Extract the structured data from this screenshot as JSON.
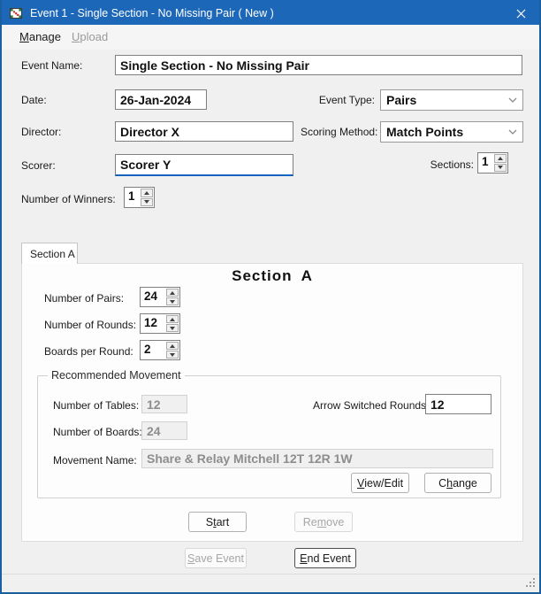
{
  "colors": {
    "titlebar": "#1c67b8",
    "window_border": "#1a5f9e",
    "focus_underline": "#1463bf",
    "disabled_text": "#8d8d8d"
  },
  "window": {
    "title": "Event 1 - Single Section - No Missing Pair ( New )"
  },
  "menu": {
    "items": [
      {
        "label": "Manage",
        "mnemonic": 0,
        "enabled": true
      },
      {
        "label": "Upload",
        "mnemonic": 0,
        "enabled": false
      }
    ]
  },
  "form": {
    "event_name": {
      "label": "Event Name:",
      "value": "Single Section - No Missing Pair"
    },
    "date": {
      "label": "Date:",
      "value": "26-Jan-2024"
    },
    "event_type": {
      "label": "Event Type:",
      "value": "Pairs"
    },
    "director": {
      "label": "Director:",
      "value": "Director X"
    },
    "scoring_method": {
      "label": "Scoring Method:",
      "value": "Match Points"
    },
    "scorer": {
      "label": "Scorer:",
      "value": "Scorer Y"
    },
    "sections": {
      "label": "Sections:",
      "value": "1"
    },
    "number_of_winners": {
      "label": "Number of Winners:",
      "value": "1"
    }
  },
  "section_tab": {
    "tab_label": "Section A",
    "heading": "Section A",
    "number_of_pairs": {
      "label": "Number of Pairs:",
      "value": "24"
    },
    "number_of_rounds": {
      "label": "Number of Rounds:",
      "value": "12"
    },
    "boards_per_round": {
      "label": "Boards per Round:",
      "value": "2"
    },
    "recommended_movement": {
      "group_label": "Recommended Movement",
      "number_of_tables": {
        "label": "Number of Tables:",
        "value": "12"
      },
      "arrow_switched_rounds": {
        "label": "Arrow Switched Rounds:",
        "value": "12"
      },
      "number_of_boards": {
        "label": "Number of Boards:",
        "value": "24"
      },
      "movement_name": {
        "label": "Movement Name:",
        "value": "Share & Relay Mitchell 12T 12R 1W"
      },
      "view_edit_button": {
        "label": "View/Edit",
        "mnemonic": 0
      },
      "change_button": {
        "label": "Change",
        "mnemonic": 1
      }
    },
    "start_button": {
      "label": "Start",
      "mnemonic": 1
    },
    "remove_button": {
      "label": "Remove",
      "mnemonic": 2
    }
  },
  "footer": {
    "save_event_button": {
      "label": "Save Event",
      "mnemonic": 0
    },
    "end_event_button": {
      "label": "End Event",
      "mnemonic": 0
    }
  }
}
